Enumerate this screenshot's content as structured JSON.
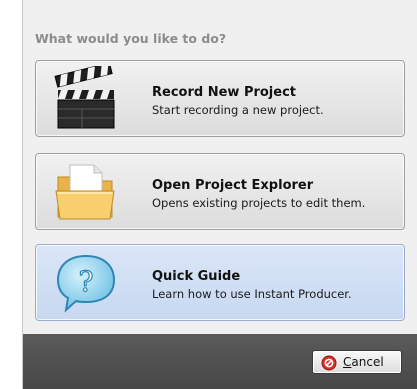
{
  "dialog": {
    "heading": "What would you like to do?",
    "options": [
      {
        "title": "Record New Project",
        "description": "Start recording a new project.",
        "icon": "clapperboard-icon"
      },
      {
        "title": "Open Project Explorer",
        "description": "Opens existing projects to edit them.",
        "icon": "folder-icon"
      },
      {
        "title": "Quick Guide",
        "description": "Learn how to use Instant Producer.",
        "icon": "help-bubble-icon",
        "selected": true
      }
    ],
    "cancel": {
      "mnemonic": "C",
      "rest": "ancel",
      "icon": "cancel-icon"
    }
  },
  "colors": {
    "selected_option": "#c7d8f1",
    "footer": "#505050",
    "cancel_icon": "#d9302c"
  }
}
